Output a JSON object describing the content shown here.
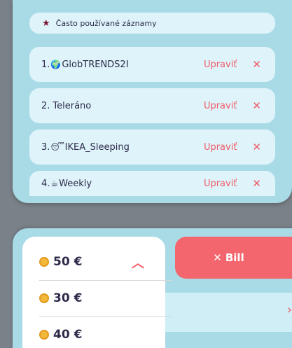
{
  "favorites": {
    "header": "Často používané záznamy",
    "items": [
      {
        "index": "1.",
        "emoji": "🌍",
        "name": "GlobTRENDS2I",
        "edit": "Upraviť"
      },
      {
        "index": "2.",
        "emoji": "",
        "name": "Teleráno",
        "edit": "Upraviť"
      },
      {
        "index": "3.",
        "emoji": "😴",
        "name": "IKEA_Sleeping",
        "edit": "Upraviť"
      },
      {
        "index": "4.",
        "emoji": "☕",
        "name": "Weekly",
        "edit": "Upraviť"
      }
    ]
  },
  "amount_dropdown": {
    "selected": "50 €",
    "options": [
      "30 €",
      "40 €"
    ]
  },
  "bill_button": {
    "label": "Bill"
  },
  "colors": {
    "panel": "#a9dbe7",
    "row": "#dff4fa",
    "accent": "#f05a66",
    "bill": "#f4666d",
    "star": "#7b1431",
    "coin": "#f2b83a"
  }
}
